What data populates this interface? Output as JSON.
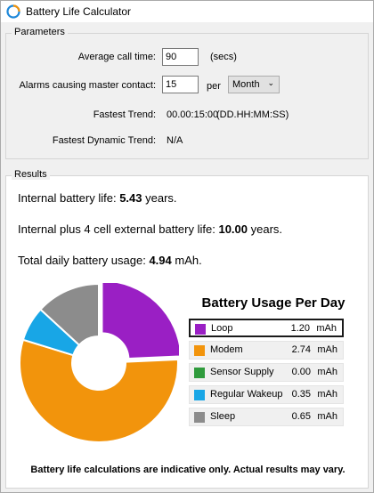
{
  "window": {
    "title": "Battery Life Calculator",
    "icon": "battery-app-icon"
  },
  "parameters": {
    "group_label": "Parameters",
    "avg_call_time": {
      "label": "Average call time:",
      "value": "90",
      "unit": "(secs)"
    },
    "alarms": {
      "label": "Alarms causing master contact:",
      "value": "15",
      "per_label": "per",
      "period_selected": "Month"
    },
    "fastest_trend": {
      "label": "Fastest Trend:",
      "value": "00.00:15:00",
      "format": "(DD.HH:MM:SS)"
    },
    "fastest_dynamic_trend": {
      "label": "Fastest Dynamic Trend:",
      "value": "N/A"
    }
  },
  "results": {
    "group_label": "Results",
    "internal_life": {
      "prefix": "Internal battery life:",
      "value": "5.43",
      "suffix": "years."
    },
    "external_life": {
      "prefix": "Internal plus 4 cell external battery life:",
      "value": "10.00",
      "suffix": "years."
    },
    "daily_usage": {
      "prefix": "Total daily battery usage:",
      "value": "4.94",
      "suffix": "mAh."
    },
    "disclaimer": "Battery life calculations are indicative only. Actual results may vary."
  },
  "chart_data": {
    "type": "pie",
    "title": "Battery Usage Per Day",
    "unit": "mAh",
    "donut": true,
    "selected": "Loop",
    "slices": [
      {
        "name": "Loop",
        "value": 1.2,
        "label": "1.20",
        "color": "#9a1fc4"
      },
      {
        "name": "Modem",
        "value": 2.74,
        "label": "2.74",
        "color": "#f2940c"
      },
      {
        "name": "Sensor Supply",
        "value": 0.0,
        "label": "0.00",
        "color": "#2f9b3c"
      },
      {
        "name": "Regular Wakeup",
        "value": 0.35,
        "label": "0.35",
        "color": "#18a6e6"
      },
      {
        "name": "Sleep",
        "value": 0.65,
        "label": "0.65",
        "color": "#8c8c8c"
      }
    ]
  }
}
